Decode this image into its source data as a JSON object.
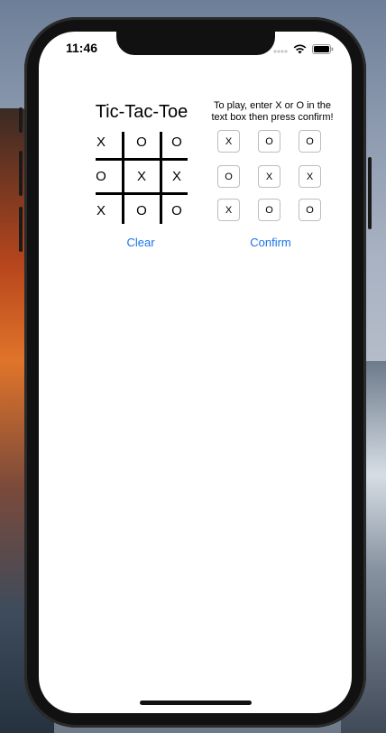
{
  "status_bar": {
    "time": "11:46",
    "icons": [
      "signal-dots-icon",
      "wifi-icon",
      "battery-icon"
    ]
  },
  "game": {
    "title": "Tic-Tac-Toe",
    "board": [
      [
        "X",
        "O",
        "O"
      ],
      [
        "O",
        "X",
        "X"
      ],
      [
        "X",
        "O",
        "O"
      ]
    ],
    "clear_label": "Clear"
  },
  "input_panel": {
    "instructions": "To play, enter X or O in the text box then press confirm!",
    "inputs": [
      [
        "X",
        "O",
        "O"
      ],
      [
        "O",
        "X",
        "X"
      ],
      [
        "X",
        "O",
        "O"
      ]
    ],
    "confirm_label": "Confirm"
  },
  "colors": {
    "link": "#1a73e8",
    "input_border": "#bdbdbd"
  }
}
